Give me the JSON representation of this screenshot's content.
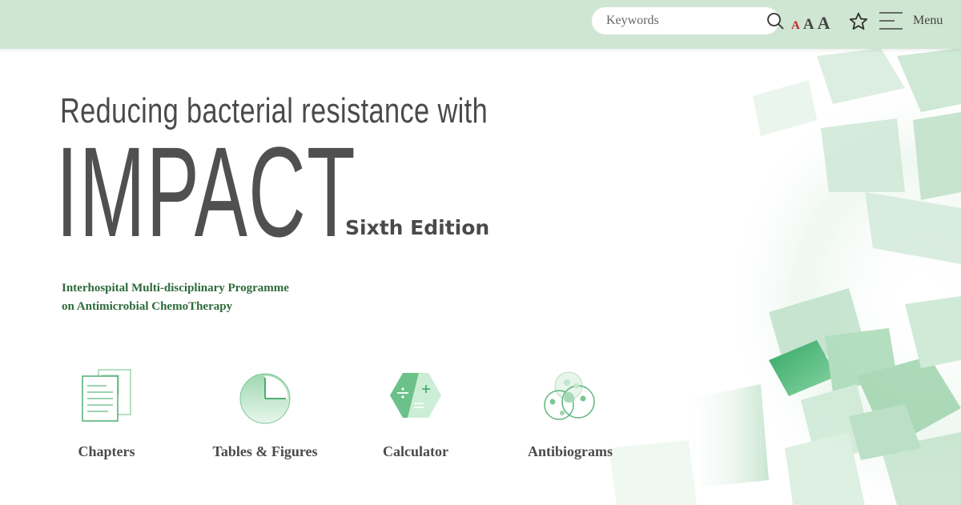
{
  "header": {
    "search": {
      "placeholder": "Keywords",
      "value": ""
    },
    "font_sizes": [
      "A",
      "A",
      "A"
    ],
    "menu_label": "Menu",
    "colors": {
      "bar": "#cfe6d2",
      "accent_red": "#c0272d"
    }
  },
  "hero": {
    "kicker": "Reducing bacterial resistance with",
    "title": "IMPACT",
    "edition": "Sixth Edition",
    "programme_line1": "Interhospital Multi-disciplinary Programme",
    "programme_line2": "on Antimicrobial ChemoTherapy"
  },
  "quick_links": [
    {
      "label": "Chapters",
      "icon": "document-icon"
    },
    {
      "label": "Tables & Figures",
      "icon": "pie-chart-icon"
    },
    {
      "label": "Calculator",
      "icon": "calculator-icon"
    },
    {
      "label": "Antibiograms",
      "icon": "bacteria-icon"
    }
  ],
  "colors": {
    "brand_green": "#2d6a3a",
    "text": "#4a4a4a",
    "icon_green": "#6cc08a"
  }
}
